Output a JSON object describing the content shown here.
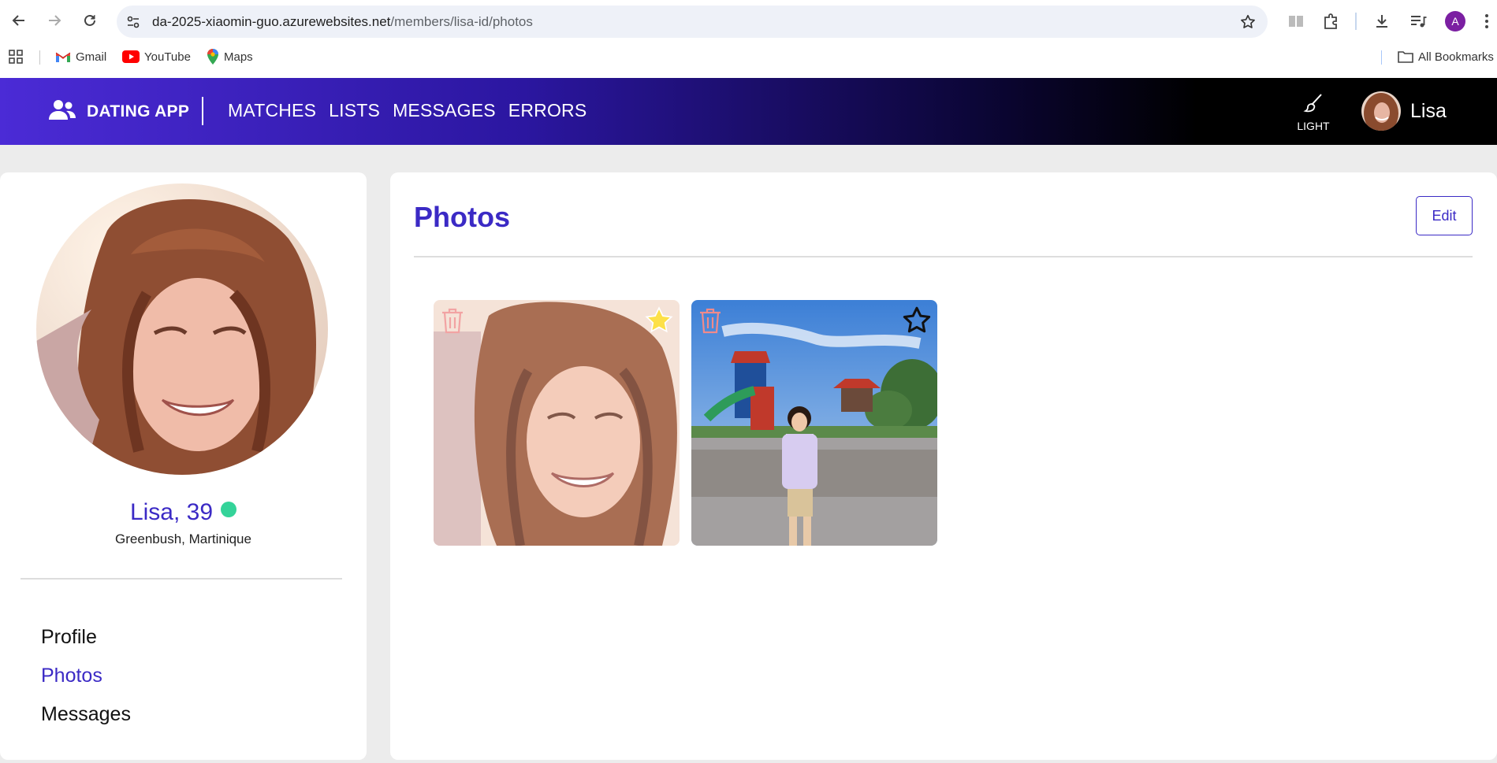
{
  "browser": {
    "url_host": "da-2025-xiaomin-guo.azurewebsites.net",
    "url_path": "/members/lisa-id/photos",
    "profile_initial": "A",
    "bookmarks": [
      {
        "label": "Gmail",
        "icon": "gmail-icon"
      },
      {
        "label": "YouTube",
        "icon": "youtube-icon"
      },
      {
        "label": "Maps",
        "icon": "maps-icon"
      }
    ],
    "all_bookmarks_label": "All Bookmarks"
  },
  "navbar": {
    "brand": "DATING APP",
    "links": [
      "MATCHES",
      "LISTS",
      "MESSAGES",
      "ERRORS"
    ],
    "theme_label": "LIGHT",
    "user_name": "Lisa"
  },
  "profile": {
    "name_age": "Lisa, 39",
    "location": "Greenbush, Martinique",
    "online": true,
    "menu": [
      {
        "label": "Profile",
        "active": false
      },
      {
        "label": "Photos",
        "active": true
      },
      {
        "label": "Messages",
        "active": false
      }
    ]
  },
  "main": {
    "title": "Photos",
    "edit_label": "Edit",
    "photos": [
      {
        "subject": "portrait-woman-curly-hair",
        "is_main": true
      },
      {
        "subject": "girl-at-playground",
        "is_main": false
      }
    ]
  },
  "colors": {
    "accent": "#3b2ac5",
    "online": "#34d399",
    "main_star": "#fde047"
  }
}
